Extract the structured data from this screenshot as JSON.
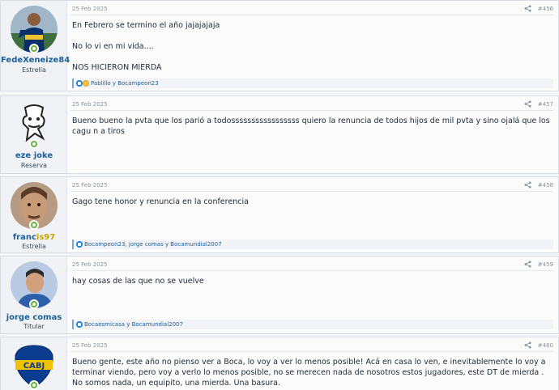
{
  "posts": [
    {
      "username": "FedeXeneize84",
      "user_title": "Estrella",
      "date": "25 Feb 2025",
      "number": "#456",
      "body": [
        "En Febrero se termino el año jajajajaja",
        "No lo vi en mi vida....",
        "NOS HICIERON MIERDA"
      ],
      "reactions": "Pablillo y Bocampeon23",
      "avatar_colors": [
        "#2a6a3a",
        "#f1c232"
      ]
    },
    {
      "username": "eze joke",
      "user_title": "Reserva",
      "date": "25 Feb 2025",
      "number": "#457",
      "body": [
        "Bueno bueno la pvta que los parió a todosssssssssssssssss quiero la renuncia de todos hijos de mil pvta y sino ojalá que los cagu n a tiros"
      ],
      "reactions": "",
      "avatar_colors": [
        "#ffffff",
        "#333333"
      ]
    },
    {
      "username_parts": [
        "franc",
        "is97"
      ],
      "user_title": "Estrella",
      "date": "25 Feb 2025",
      "number": "#458",
      "body": [
        "Gago tene honor y renuncia en la conferencia"
      ],
      "reactions": "Bocampeon23, jorge comas y Bocamundial2007",
      "avatar_colors": [
        "#8a5a3a",
        "#c9a27a"
      ]
    },
    {
      "username": "jorge comas",
      "user_title": "Titular",
      "date": "25 Feb 2025",
      "number": "#459",
      "body": [
        "hay cosas de las que no se vuelve"
      ],
      "reactions": "Bocaesmicasa y Bocamundial2007",
      "avatar_colors": [
        "#4a78b5",
        "#c8d6ea"
      ]
    },
    {
      "username": "",
      "user_title": "",
      "date": "25 Feb 2025",
      "number": "#460",
      "body": [
        "Bueno gente, este año no pienso ver a Boca, lo voy a ver lo menos posible! Acá en casa lo ven, e inevitablemente lo voy a terminar viendo, pero voy a verlo lo menos posible, no se merecen nada de nosotros estos jugadores, este DT de mierda . No somos nada, un equipito, una mierda. Una basura."
      ],
      "reactions": "",
      "avatar_colors": [
        "#0a3d8f",
        "#f2c200"
      ]
    }
  ],
  "crest_text": "CABJ"
}
